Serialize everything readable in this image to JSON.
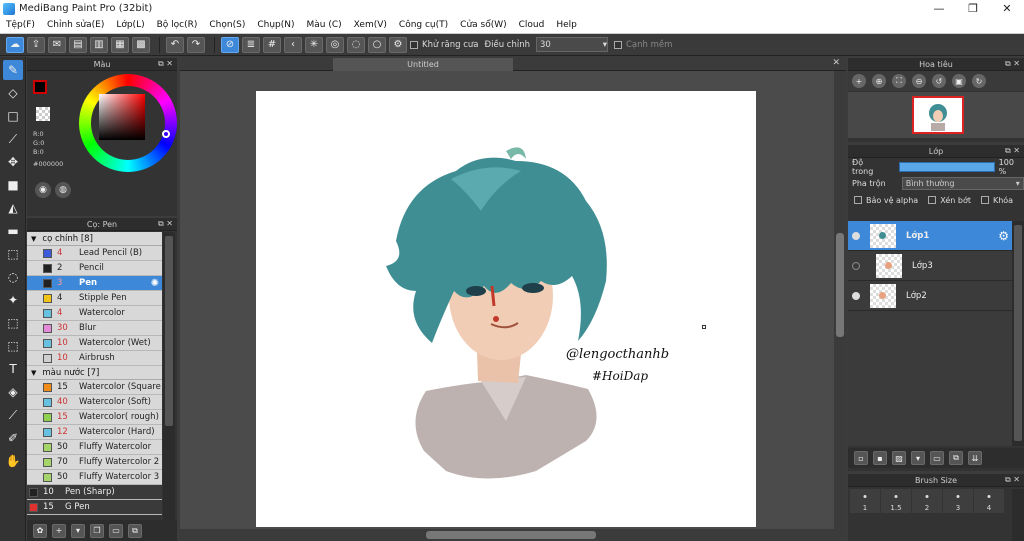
{
  "window": {
    "title": "MediBang Paint Pro (32bit)",
    "minimize": "—",
    "restore": "❐",
    "close": "✕"
  },
  "menu": [
    "Tệp(F)",
    "Chỉnh sửa(E)",
    "Lớp(L)",
    "Bộ lọc(R)",
    "Chọn(S)",
    "Chụp(N)",
    "Màu (C)",
    "Xem(V)",
    "Công cụ(T)",
    "Cửa sổ(W)",
    "Cloud",
    "Help"
  ],
  "toolbar": {
    "antialias_label": "Khử răng cưa",
    "correction_label": "Điều chỉnh",
    "correction_value": "30",
    "soft_edge_label": "Cạnh mềm"
  },
  "color_panel": {
    "title": "Màu",
    "r": "R:0",
    "g": "G:0",
    "b": "B:0",
    "hex": "#000000"
  },
  "brush_panel": {
    "title": "Cọ: Pen",
    "groups": [
      {
        "name": "cọ chính [8]",
        "items": [
          {
            "size": "4",
            "name": "Lead Pencil (B)",
            "color": "#3b5bdb"
          },
          {
            "size": "2",
            "name": "Pencil",
            "color": "#222222"
          },
          {
            "size": "3",
            "name": "Pen",
            "color": "#222222",
            "selected": true
          },
          {
            "size": "4",
            "name": "Stipple Pen",
            "color": "#f0c419"
          },
          {
            "size": "4",
            "name": "Watercolor",
            "color": "#66c2e0"
          },
          {
            "size": "30",
            "name": "Blur",
            "color": "#e58ad8"
          },
          {
            "size": "10",
            "name": "Watercolor (Wet)",
            "color": "#66c2e0"
          },
          {
            "size": "10",
            "name": "Airbrush",
            "color": "#cfcfcf"
          }
        ]
      },
      {
        "name": "màu nước [7]",
        "items": [
          {
            "size": "15",
            "name": "Watercolor (Square",
            "color": "#f08c1a"
          },
          {
            "size": "40",
            "name": "Watercolor (Soft)",
            "color": "#66c2e0"
          },
          {
            "size": "15",
            "name": "Watercolor( rough)",
            "color": "#8fd14f"
          },
          {
            "size": "12",
            "name": "Watercolor (Hard)",
            "color": "#66c2e0"
          },
          {
            "size": "50",
            "name": "Fluffy Watercolor",
            "color": "#a5d46a"
          },
          {
            "size": "70",
            "name": "Fluffy Watercolor 2",
            "color": "#a5d46a"
          },
          {
            "size": "50",
            "name": "Fluffy Watercolor 3",
            "color": "#a5d46a"
          }
        ]
      }
    ],
    "outer_items": [
      {
        "size": "10",
        "name": "Pen (Sharp)",
        "color": "#222222"
      },
      {
        "size": "15",
        "name": "G Pen",
        "color": "#e03131"
      }
    ]
  },
  "canvas": {
    "tab_title": "Untitled",
    "signature_line1": "@lengocthanhb",
    "signature_line2": "#HoiDap"
  },
  "navigator": {
    "title": "Hoa tiêu"
  },
  "layer_panel": {
    "title": "Lớp",
    "opacity_label": "Độ trong",
    "opacity_value": "100 %",
    "opacity_fraction": 1.0,
    "blend_label": "Pha trộn",
    "blend_value": "Bình thường",
    "protect_alpha": "Bảo vệ alpha",
    "clipping": "Xén bớt",
    "lock": "Khóa",
    "layers": [
      {
        "name": "Lớp1",
        "selected": true,
        "visible": true
      },
      {
        "name": "Lớp3",
        "selected": false,
        "visible": false
      },
      {
        "name": "Lớp2",
        "selected": false,
        "visible": true
      }
    ]
  },
  "brush_size_panel": {
    "title": "Brush Size",
    "sizes": [
      "1",
      "1.5",
      "2",
      "3",
      "4"
    ]
  }
}
